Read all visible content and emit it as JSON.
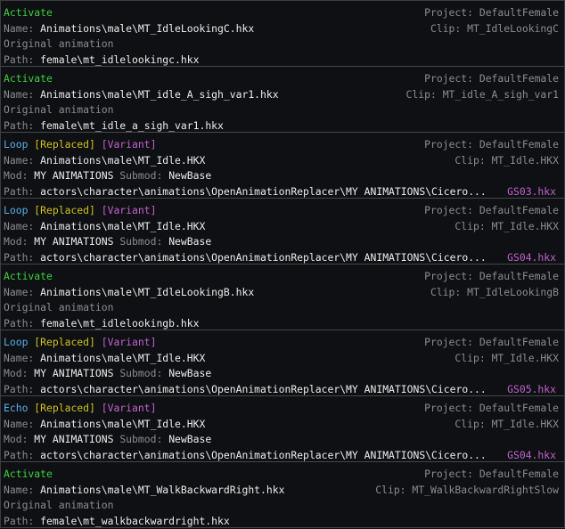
{
  "labels": {
    "name": "Name:",
    "mod": "Mod:",
    "submod": "Submod:",
    "path": "Path:",
    "project": "Project:",
    "clip": "Clip:",
    "original": "Original animation"
  },
  "colors": {
    "activate": "#3fd03f",
    "loop": "#5ab0ec",
    "replaced": "#d2c31c",
    "variant": "#c462d0"
  },
  "entries": [
    {
      "type": "Activate",
      "tags": [],
      "name": "Animations\\male\\MT_IdleLookingC.hkx",
      "project": "DefaultFemale",
      "clip": "MT_IdleLookingC",
      "original": true,
      "path": "female\\mt_idlelookingc.hkx"
    },
    {
      "type": "Activate",
      "tags": [],
      "name": "Animations\\male\\MT_idle_A_sigh_var1.hkx",
      "project": "DefaultFemale",
      "clip": "MT_idle_A_sigh_var1",
      "original": true,
      "path": "female\\mt_idle_a_sigh_var1.hkx"
    },
    {
      "type": "Loop",
      "tags": [
        "[Replaced]",
        "[Variant]"
      ],
      "name": "Animations\\male\\MT_Idle.HKX",
      "project": "DefaultFemale",
      "clip": "MT_Idle.HKX",
      "mod": "MY ANIMATIONS",
      "submod": "NewBase",
      "path": "actors\\character\\animations\\OpenAnimationReplacer\\MY ANIMATIONS\\Cicero...",
      "file": "GS03.hkx"
    },
    {
      "type": "Loop",
      "tags": [
        "[Replaced]",
        "[Variant]"
      ],
      "name": "Animations\\male\\MT_Idle.HKX",
      "project": "DefaultFemale",
      "clip": "MT_Idle.HKX",
      "mod": "MY ANIMATIONS",
      "submod": "NewBase",
      "path": "actors\\character\\animations\\OpenAnimationReplacer\\MY ANIMATIONS\\Cicero...",
      "file": "GS04.hkx"
    },
    {
      "type": "Activate",
      "tags": [],
      "name": "Animations\\male\\MT_IdleLookingB.hkx",
      "project": "DefaultFemale",
      "clip": "MT_IdleLookingB",
      "original": true,
      "path": "female\\mt_idlelookingb.hkx"
    },
    {
      "type": "Loop",
      "tags": [
        "[Replaced]",
        "[Variant]"
      ],
      "name": "Animations\\male\\MT_Idle.HKX",
      "project": "DefaultFemale",
      "clip": "MT_Idle.HKX",
      "mod": "MY ANIMATIONS",
      "submod": "NewBase",
      "path": "actors\\character\\animations\\OpenAnimationReplacer\\MY ANIMATIONS\\Cicero...",
      "file": "GS05.hkx"
    },
    {
      "type": "Echo",
      "tags": [
        "[Replaced]",
        "[Variant]"
      ],
      "name": "Animations\\male\\MT_Idle.HKX",
      "project": "DefaultFemale",
      "clip": "MT_Idle.HKX",
      "mod": "MY ANIMATIONS",
      "submod": "NewBase",
      "path": "actors\\character\\animations\\OpenAnimationReplacer\\MY ANIMATIONS\\Cicero...",
      "file": "GS04.hkx"
    },
    {
      "type": "Activate",
      "tags": [],
      "name": "Animations\\male\\MT_WalkBackwardRight.hkx",
      "project": "DefaultFemale",
      "clip": "MT_WalkBackwardRightSlow",
      "original": true,
      "path": "female\\mt_walkbackwardright.hkx"
    }
  ]
}
